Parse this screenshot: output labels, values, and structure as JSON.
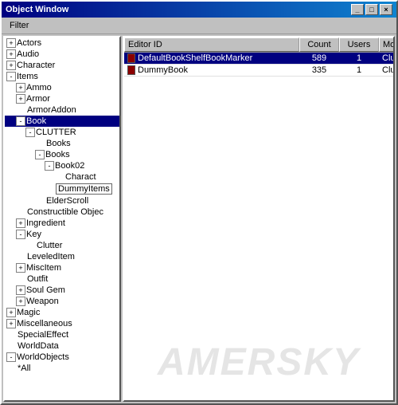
{
  "window": {
    "title": "Object Window",
    "close_label": "×",
    "minimize_label": "_",
    "maximize_label": "□"
  },
  "menu": {
    "filter_label": "Filter"
  },
  "tree": {
    "items": [
      {
        "id": "actors",
        "label": "Actors",
        "level": 0,
        "toggle": "+",
        "expanded": false
      },
      {
        "id": "audio",
        "label": "Audio",
        "level": 0,
        "toggle": "+",
        "expanded": false
      },
      {
        "id": "character",
        "label": "Character",
        "level": 0,
        "toggle": "+",
        "expanded": false
      },
      {
        "id": "items",
        "label": "Items",
        "level": 0,
        "toggle": "-",
        "expanded": true,
        "selected": false
      },
      {
        "id": "ammo",
        "label": "Ammo",
        "level": 1,
        "toggle": "+",
        "expanded": false
      },
      {
        "id": "armor",
        "label": "Armor",
        "level": 1,
        "toggle": "+",
        "expanded": false
      },
      {
        "id": "armoraddon",
        "label": "ArmorAddon",
        "level": 1,
        "toggle": null,
        "expanded": false
      },
      {
        "id": "book",
        "label": "Book",
        "level": 1,
        "toggle": "-",
        "expanded": true,
        "selected": true
      },
      {
        "id": "clutter",
        "label": "CLUTTER",
        "level": 2,
        "toggle": "-",
        "expanded": true
      },
      {
        "id": "books1",
        "label": "Books",
        "level": 3,
        "toggle": null,
        "expanded": false
      },
      {
        "id": "books2",
        "label": "Books",
        "level": 3,
        "toggle": "-",
        "expanded": true
      },
      {
        "id": "book02",
        "label": "Book02",
        "level": 4,
        "toggle": "-",
        "expanded": true
      },
      {
        "id": "charact",
        "label": "Charact",
        "level": 5,
        "toggle": null,
        "expanded": false
      },
      {
        "id": "dummyitems",
        "label": "DummyItems",
        "level": 4,
        "toggle": null,
        "expanded": false,
        "boxed": true
      },
      {
        "id": "elderscroll",
        "label": "ElderScroll",
        "level": 3,
        "toggle": null,
        "expanded": false
      },
      {
        "id": "constructible",
        "label": "Constructible Objec",
        "level": 1,
        "toggle": null,
        "expanded": false
      },
      {
        "id": "ingredient",
        "label": "Ingredient",
        "level": 1,
        "toggle": "+",
        "expanded": false
      },
      {
        "id": "key",
        "label": "Key",
        "level": 1,
        "toggle": "-",
        "expanded": true
      },
      {
        "id": "clutter2",
        "label": "Clutter",
        "level": 2,
        "toggle": null,
        "expanded": false
      },
      {
        "id": "leveleditem",
        "label": "LeveledItem",
        "level": 1,
        "toggle": null,
        "expanded": false
      },
      {
        "id": "miscitem",
        "label": "MiscItem",
        "level": 1,
        "toggle": "+",
        "expanded": false
      },
      {
        "id": "outfit",
        "label": "Outfit",
        "level": 1,
        "toggle": null,
        "expanded": false
      },
      {
        "id": "soulgem",
        "label": "Soul Gem",
        "level": 1,
        "toggle": "+",
        "expanded": false
      },
      {
        "id": "weapon",
        "label": "Weapon",
        "level": 1,
        "toggle": "+",
        "expanded": false
      },
      {
        "id": "magic",
        "label": "Magic",
        "level": 0,
        "toggle": "+",
        "expanded": false
      },
      {
        "id": "miscellaneous",
        "label": "Miscellaneous",
        "level": 0,
        "toggle": "+",
        "expanded": false
      },
      {
        "id": "specialeffect",
        "label": "SpecialEffect",
        "level": 0,
        "toggle": null,
        "expanded": false
      },
      {
        "id": "worlddata",
        "label": "WorldData",
        "level": 0,
        "toggle": null,
        "expanded": false
      },
      {
        "id": "worldobjects",
        "label": "WorldObjects",
        "level": 0,
        "toggle": "-",
        "expanded": true
      },
      {
        "id": "all",
        "label": "*All",
        "level": 0,
        "toggle": null,
        "expanded": false
      }
    ]
  },
  "table": {
    "columns": [
      {
        "id": "editor_id",
        "label": "Editor ID"
      },
      {
        "id": "count",
        "label": "Count"
      },
      {
        "id": "users",
        "label": "Users"
      },
      {
        "id": "model",
        "label": "Model"
      }
    ],
    "rows": [
      {
        "editor_id": "DefaultBookShelfBookMarker",
        "count": "589",
        "users": "1",
        "model": "Clutter\\D",
        "selected": true,
        "has_icon": true
      },
      {
        "editor_id": "DummyBook",
        "count": "335",
        "users": "1",
        "model": "Clutter\\D",
        "selected": false,
        "has_icon": true
      }
    ]
  },
  "watermark": {
    "text": "AMERSKY"
  }
}
